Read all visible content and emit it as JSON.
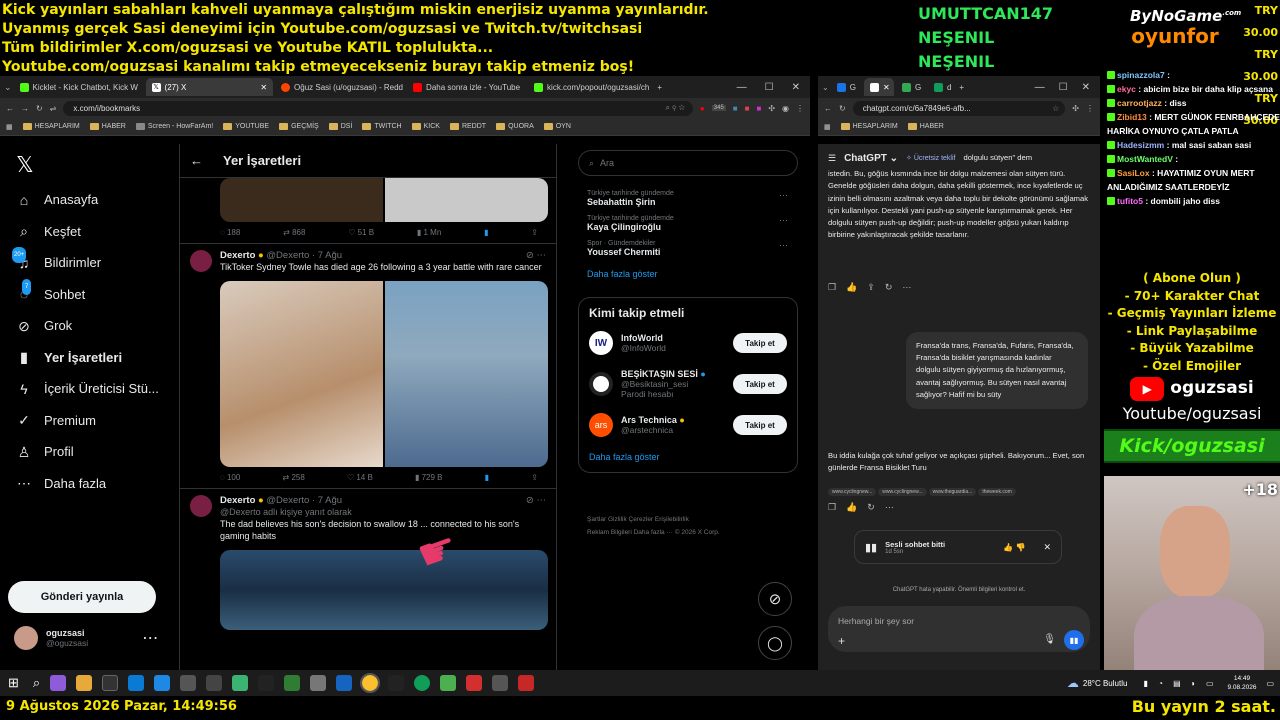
{
  "banner": {
    "line1": "Kick yayınları sabahları kahveli uyanmaya çalıştığım miskin enerjisiz uyanma yayınlarıdır.",
    "line2": "Uyanmış gerçek Sasi deneyimi için Youtube.com/oguzsasi ve Twitch.tv/twitchsasi",
    "line3": "Tüm bildirimler X.com/oguzsasi ve Youtube KATIL toplulukta...",
    "line4": "Youtube.com/oguzsasi kanalımı takip etmeyecekseniz burayı takip etmeniz boş!"
  },
  "donors": [
    "UMUTTCAN147",
    "NEŞENIL",
    "NEŞENIL"
  ],
  "logos": {
    "top": "ByNoGame",
    "top_small": ".com",
    "bottom": "oyunfor"
  },
  "tries": [
    "TRY 30.00",
    "TRY 30.00",
    "TRY 30.00"
  ],
  "left_browser": {
    "tabs": [
      "Kicklet - Kick Chatbot, Kick W",
      "(27) X",
      "Oğuz Sasi (u/oguzsasi) - Redd",
      "Daha sonra izle - YouTube",
      "kick.com/popout/oguzsasi/ch"
    ],
    "url": "x.com/i/bookmarks",
    "bookmarks": [
      "HESAPLARIM",
      "HABER",
      "Screen - HowFarAm!",
      "YOUTUBE",
      "GEÇMİŞ",
      "DSİ",
      "TWITCH",
      "KICK",
      "REDDT",
      "QUORA",
      "OYN"
    ],
    "badge": "345"
  },
  "x": {
    "nav": [
      "Anasayfa",
      "Keşfet",
      "Bildirimler",
      "Sohbet",
      "Grok",
      "Yer İşaretleri",
      "İçerik Üreticisi Stü...",
      "Premium",
      "Profil",
      "Daha fazla"
    ],
    "notif_badge": "20+",
    "chat_badge": "7",
    "post_button": "Gönderi yayınla",
    "user_name": "oguzsasi",
    "user_handle": "@oguzsasi",
    "page_title": "Yer İşaretleri",
    "tweet0_actions": [
      "188",
      "868",
      "51 B",
      "1 Mn"
    ],
    "tweet1": {
      "name": "Dexerto",
      "handle": "@Dexerto · 7 Ağu",
      "text": "TikToker Sydney Towle has died age 26 following a 3 year battle with rare cancer",
      "actions": [
        "100",
        "258",
        "14 B",
        "729 B"
      ]
    },
    "tweet2": {
      "name": "Dexerto",
      "handle": "@Dexerto · 7 Ağu",
      "reply": "@Dexerto adlı kişiye yanıt olarak",
      "text": "The dad believes his son's decision to swallow 18 ... connected to his son's gaming habits"
    },
    "search_placeholder": "Ara",
    "trends": [
      {
        "sub": "Türkiye tarihinde gündemde",
        "title": "Sebahattin Şirin"
      },
      {
        "sub": "Türkiye tarihinde gündemde",
        "title": "Kaya Çilingiroğlu"
      },
      {
        "sub": "Spor · Gündemdekiler",
        "title": "Youssef Chermiti"
      }
    ],
    "show_more": "Daha fazla göster",
    "who_title": "Kimi takip etmeli",
    "follow": [
      {
        "name": "InfoWorld",
        "handle": "@InfoWorld",
        "extra": "",
        "icon": "IW",
        "btn": "Takip et"
      },
      {
        "name": "BEŞİKTAŞIN SESİ",
        "handle": "@Besiktasin_sesi",
        "extra": "Parodi hesabı",
        "icon": "",
        "btn": "Takip et"
      },
      {
        "name": "Ars Technica",
        "handle": "@arstechnica",
        "extra": "",
        "icon": "ars",
        "btn": "Takip et"
      }
    ],
    "footer1": "Şartlar   Gizlilik   Çerezler   Erişilebilirlik",
    "footer2": "Reklam Bilgileri   Daha fazla ···  © 2026 X Corp."
  },
  "right_browser": {
    "url": "chatgpt.com/c/6a7849e6-afb...",
    "bookmarks": [
      "HESAPLARIM",
      "HABER"
    ]
  },
  "gpt": {
    "model": "ChatGPT",
    "free_offer": "Ücretsiz teklif",
    "top_text_end": "dolgulu sütyen\" dem",
    "reply1": "istedin. Bu, göğüs kısmında ince bir dolgu malzemesi olan sütyen türü. Genelde göğüsleri daha dolgun, daha şekilli göstermek, ince kıyafetlerde uç izinin belli olmasını azaltmak veya daha toplu bir dekolte görünümü sağlamak için kullanılıyor. Destekli yani push-up sütyenle karıştırmamak gerek. Her dolgulu sütyen push-up değildir; push-up modeller göğsü yukarı kaldırıp birbirine yakınlaştıracak şekilde tasarlanır.",
    "user_msg": "Fransa'da trans, Fransa'da, Fufaris, Fransa'da, Fransa'da bisiklet yarışmasında kadınlar dolgulu sütyen giyiyormuş da hızlanıyormuş, avantaj sağlıyormuş. Bu sütyen nasıl avantaj sağlıyor? Hafif mi bu süty",
    "reply2": "Bu iddia kulağa çok tuhaf geliyor ve açıkçası şüpheli. Bakıyorum... Evet, son günlerde Fransa Bisiklet Turu",
    "sources": [
      "www.cyclingnew...",
      "www.cyclingnew...",
      "www.theguardia...",
      "theweek.com"
    ],
    "voice_title": "Sesli sohbet bitti",
    "voice_sub": "1d 5sn",
    "disclaimer": "ChatGPT hata yapabilir. Önemli bilgileri kontrol et.",
    "input_placeholder": "Herhangi bir şey sor"
  },
  "chat": [
    {
      "user": "spinazzola7",
      "text": ":",
      "color": "#7ec8ff"
    },
    {
      "user": "ekyc",
      "text": ": abicim bize bir daha klip açsana",
      "color": "#ff6b9a"
    },
    {
      "user": "carrootjazz",
      "text": ": diss",
      "color": "#ffb05a"
    },
    {
      "user": "Zibid13",
      "text": ": MERT GÜNOK FENRBAHÇEDE HARİKA OYNUYO ÇATLA PATLA",
      "color": "#ff8c3a"
    },
    {
      "user": "Hadesizmm",
      "text": ": mal sasi saban sasi",
      "color": "#a0b4ff"
    },
    {
      "user": "MostWantedV",
      "text": ":",
      "color": "#6cff6c"
    },
    {
      "user": "SasiLox",
      "text": ": HAYATIMIZ OYUN MERT ANLADIĞIMIZ SAATLERDEYİZ",
      "color": "#ffa040"
    },
    {
      "user": "tufito5",
      "text": ": dombili jaho diss",
      "color": "#ff6cff"
    }
  ],
  "promo": [
    "( Abone Olun )",
    "- 70+ Karakter Chat",
    "- Geçmiş Yayınları İzleme",
    "- Link Paylaşabilme",
    "- Büyük Yazabilme",
    "- Özel Emojiler"
  ],
  "yt_name": "oguzsasi",
  "yt_url": "Youtube/oguzsasi",
  "kick_url": "Kick/oguzsasi",
  "plus": "+18",
  "taskbar": {
    "weather": "28°C  Bulutlu",
    "time": "14:49",
    "date": "9.08.2026"
  },
  "bottom": {
    "left": "9 Ağustos 2026 Pazar, 14:49:56",
    "right": "Bu yayın 2 saat."
  }
}
